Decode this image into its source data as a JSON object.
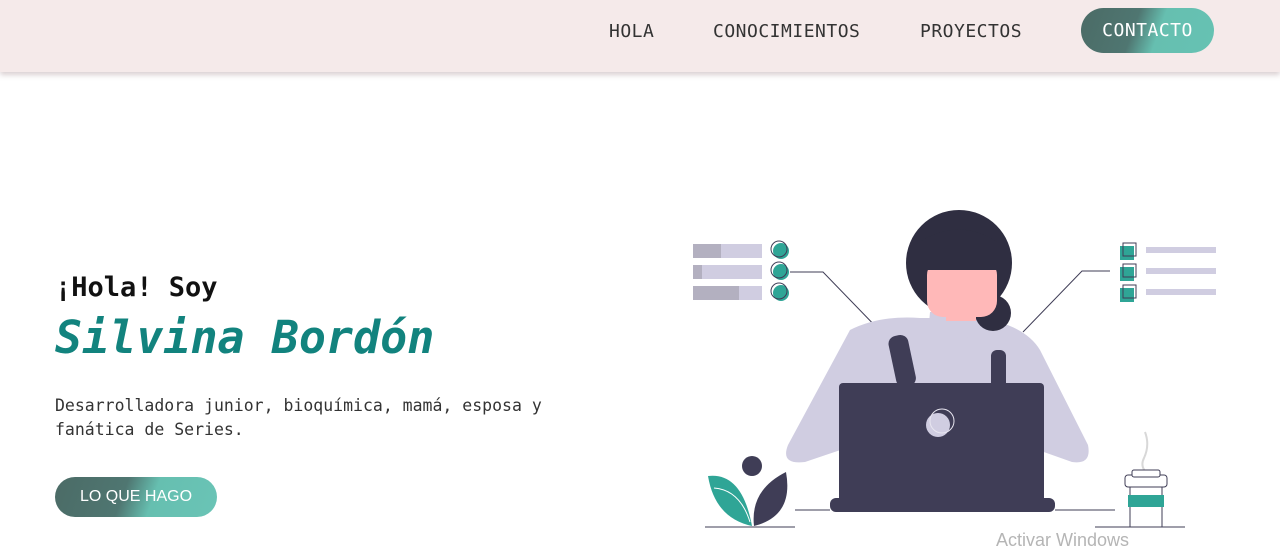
{
  "nav": {
    "links": [
      "HOLA",
      "CONOCIMIENTOS",
      "PROYECTOS"
    ],
    "contact_label": "CONTACTO"
  },
  "hero": {
    "greeting": "¡Hola! Soy",
    "name": "Silvina Bordón",
    "bio": "Desarrolladora junior, bioquímica, mamá, esposa y fanática de Series.",
    "cta_label": "LO QUE HAGO"
  },
  "watermark": "Activar Windows",
  "colors": {
    "navbar_bg": "#f5eaea",
    "accent_teal": "#12837e",
    "button_dark": "#4b6b66",
    "button_light": "#66c2b3",
    "illustration_dark": "#3f3d56",
    "illustration_lavender": "#d0cde1",
    "illustration_teal": "#2fa596",
    "skin": "#ffb8b8"
  },
  "icons": [
    "woman-at-laptop-illustration",
    "progress-list-icon",
    "checklist-icon",
    "plant-icon",
    "coffee-cup-icon"
  ]
}
